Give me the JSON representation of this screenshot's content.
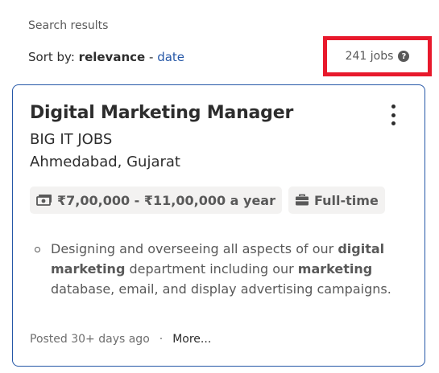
{
  "header": {
    "search_results_label": "Search results",
    "sort_by_label": "Sort by:",
    "sort_active": "relevance",
    "sort_separator": "-",
    "sort_alternative": "date",
    "job_count": "241 jobs",
    "help_glyph": "?"
  },
  "job": {
    "title": "Digital Marketing Manager",
    "company": "BIG IT JOBS",
    "location": "Ahmedabad, Gujarat",
    "salary": "₹7,00,000 - ₹11,00,000 a year",
    "job_type": "Full-time",
    "snippet": [
      {
        "text": "Designing and overseeing all aspects of our ",
        "bold": false
      },
      {
        "text": "digital marketing",
        "bold": true
      },
      {
        "text": " department including our ",
        "bold": false
      },
      {
        "text": "marketing",
        "bold": true
      },
      {
        "text": " database, email, and display advertising campaigns.",
        "bold": false
      }
    ],
    "posted": "Posted 30+ days ago",
    "footer_separator": "·",
    "more_link": "More..."
  },
  "colors": {
    "link": "#2557a7",
    "highlight_border": "#e8192c",
    "tag_background": "#f3f2f1"
  },
  "icons": [
    "help-icon",
    "kebab-menu-icon",
    "salary-icon",
    "briefcase-icon"
  ]
}
